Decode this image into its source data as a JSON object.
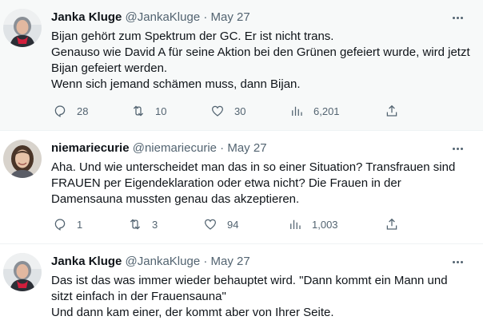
{
  "tweets": [
    {
      "name": "Janka Kluge",
      "handle": "@JankaKluge",
      "dot": "·",
      "date": "May 27",
      "lines": [
        "Bijan gehört zum Spektrum der GC. Er ist nicht trans.",
        "Genauso wie David A für seine Aktion bei den Grünen gefeiert wurde, wird jetzt Bijan gefeiert werden.",
        "Wenn sich jemand schämen muss, dann Bijan."
      ],
      "replies": "28",
      "retweets": "10",
      "likes": "30",
      "views": "6,201"
    },
    {
      "name": "niemariecurie",
      "handle": "@niemariecurie",
      "dot": "·",
      "date": "May 27",
      "lines": [
        "Aha. Und wie unterscheidet man das in so einer Situation? Transfrauen sind FRAUEN per Eigendeklaration oder etwa nicht? Die Frauen in der Damensauna mussten genau das akzeptieren."
      ],
      "replies": "1",
      "retweets": "3",
      "likes": "94",
      "views": "1,003"
    },
    {
      "name": "Janka Kluge",
      "handle": "@JankaKluge",
      "dot": "·",
      "date": "May 27",
      "lines": [
        "Das ist das was immer wieder behauptet wird. \"Dann kommt ein Mann und sitzt einfach in der Frauensauna\"",
        "Und dann kam einer, der kommt aber von Ihrer Seite."
      ]
    }
  ],
  "colors": {
    "name": "#0f1419",
    "meta": "#536471",
    "highlight_bg": "#f7f9f9",
    "avatar_bg": "#c9cfd4",
    "scarf": "#d21e3c"
  },
  "icons": [
    "more-icon",
    "reply-icon",
    "retweet-icon",
    "like-icon",
    "views-icon",
    "share-icon"
  ]
}
